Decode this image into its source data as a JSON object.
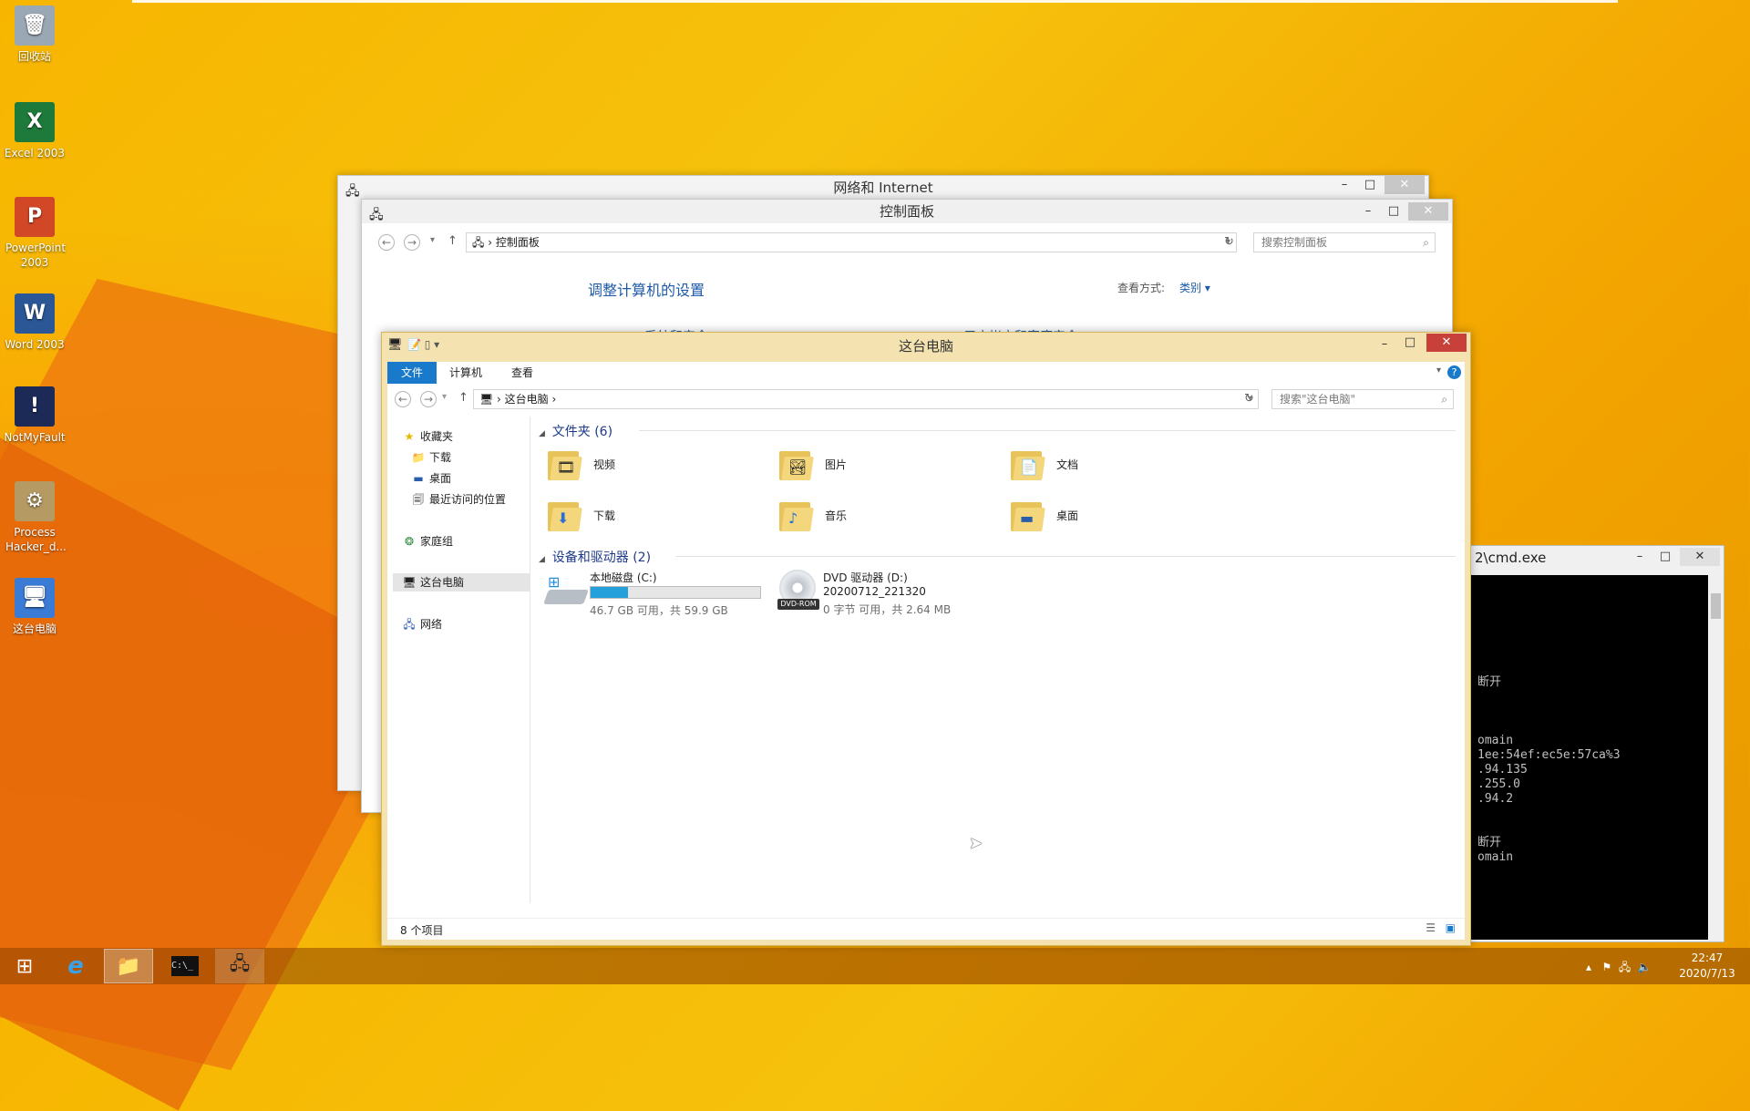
{
  "desktop_icons": [
    {
      "label": "回收站",
      "glyph": "🗑"
    },
    {
      "label": "Excel 2003",
      "glyph": "X"
    },
    {
      "label": "PowerPoint 2003",
      "glyph": "P"
    },
    {
      "label": "Word 2003",
      "glyph": "W"
    },
    {
      "label": "NotMyFault",
      "glyph": "!"
    },
    {
      "label": "Process Hacker_d...",
      "glyph": "⚙"
    },
    {
      "label": "这台电脑",
      "glyph": "🖥"
    }
  ],
  "network_window": {
    "title": "网络和 Internet"
  },
  "control_panel": {
    "title": "控制面板",
    "address": "控制面板",
    "search_placeholder": "搜索控制面板",
    "heading": "调整计算机的设置",
    "view_by_label": "查看方式:",
    "view_by_value": "类别",
    "partial_item_1": "系统和安全",
    "partial_item_2": "用户帐户和家庭安全"
  },
  "explorer": {
    "title": "这台电脑",
    "ribbon_tabs": [
      "文件",
      "计算机",
      "查看"
    ],
    "address": "这台电脑",
    "search_placeholder": "搜索\"这台电脑\"",
    "nav": {
      "favorites": "收藏夹",
      "downloads": "下载",
      "desktop": "桌面",
      "recent": "最近访问的位置",
      "homegroup": "家庭组",
      "this_pc": "这台电脑",
      "network": "网络"
    },
    "folders_header": "文件夹 (6)",
    "folders": [
      "视频",
      "图片",
      "文档",
      "下载",
      "音乐",
      "桌面"
    ],
    "drives_header": "设备和驱动器 (2)",
    "drive_c": {
      "name": "本地磁盘 (C:)",
      "usage": "46.7 GB 可用，共 59.9 GB",
      "used_fraction": 0.22
    },
    "drive_d": {
      "name": "DVD 驱动器 (D:)",
      "volume": "20200712_221320",
      "usage": "0 字节 可用，共 2.64 MB",
      "badge": "DVD-ROM"
    },
    "status": "8 个项目"
  },
  "cmd": {
    "title": "2\\cmd.exe",
    "lines": [
      "断开",
      "",
      "",
      "",
      "omain",
      "1ee:54ef:ec5e:57ca%3",
      ".94.135",
      ".255.0",
      ".94.2",
      "",
      "",
      "断开",
      "omain"
    ]
  },
  "taskbar": {
    "time": "22:47",
    "date": "2020/7/13"
  }
}
